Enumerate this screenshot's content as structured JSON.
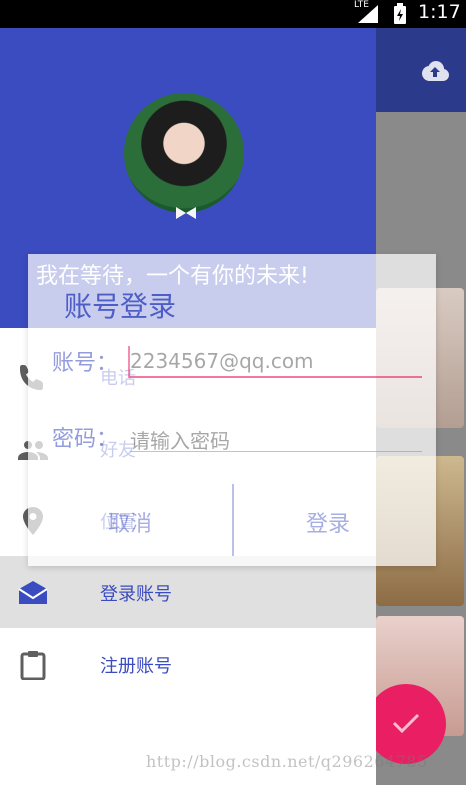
{
  "status_bar": {
    "network": "LTE",
    "time": "1:17"
  },
  "drawer": {
    "menu_items": [
      {
        "label": "电话",
        "icon": "phone-icon"
      },
      {
        "label": "好友",
        "icon": "people-icon"
      },
      {
        "label": "位置",
        "icon": "location-icon"
      },
      {
        "label": "登录账号",
        "icon": "mail-icon",
        "selected": true
      },
      {
        "label": "注册账号",
        "icon": "clipboard-icon"
      }
    ]
  },
  "dialog": {
    "bubble_text": "我在等待，一个有你的未来!",
    "title": "账号登录",
    "account_label": "账号：",
    "account_value": "2234567@qq.com",
    "password_label": "密码：",
    "password_placeholder": "请输入密码",
    "cancel_label": "取消",
    "login_label": "登录"
  },
  "watermark": "http://blog.csdn.net/q296264785",
  "colors": {
    "primary": "#3b4bc0",
    "accent": "#e91e63",
    "status_bar": "#000000"
  }
}
